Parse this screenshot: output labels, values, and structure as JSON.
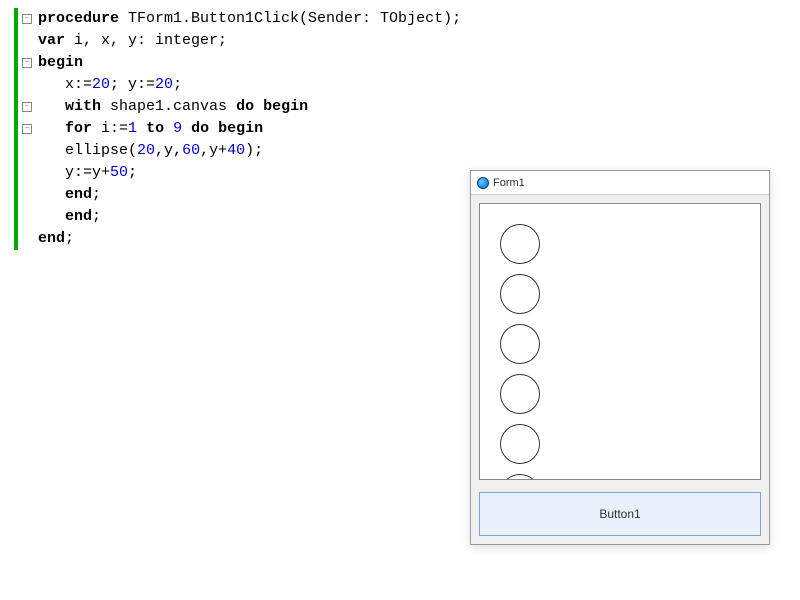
{
  "code": {
    "line1": {
      "t1": "procedure",
      "t2": " TForm1.Button1Click(Sender: TObject);"
    },
    "line2": {
      "t1": "var",
      "t2": " i, x, y: integer;"
    },
    "line3": {
      "t1": "begin"
    },
    "line4": {
      "pad": "   x:=",
      "n1": "20",
      "mid1": "; y:=",
      "n2": "20",
      "end": ";"
    },
    "line5": {
      "pad": "   ",
      "t1": "with",
      "t2": " shape1.canvas ",
      "t3": "do begin"
    },
    "line6": {
      "pad": "   ",
      "t1": "for",
      "t2": " i:=",
      "n1": "1",
      "mid": " ",
      "t3": "to",
      "sp": " ",
      "n2": "9",
      "sp2": " ",
      "t4": "do begin"
    },
    "line7": {
      "pad": "   ellipse(",
      "n1": "20",
      "c1": ",y,",
      "n2": "60",
      "c2": ",y+",
      "n3": "40",
      "end": ");"
    },
    "line8": {
      "pad": "   y:=y+",
      "n1": "50",
      "end": ";"
    },
    "line9": {
      "pad": "   ",
      "t1": "end",
      "end": ";"
    },
    "line10": {
      "pad": "   ",
      "t1": "end",
      "end": ";"
    },
    "line11": {
      "t1": "end",
      "end": ";"
    }
  },
  "gutter": {
    "fold": "−"
  },
  "form": {
    "title": "Form1",
    "button_label": "Button1"
  }
}
